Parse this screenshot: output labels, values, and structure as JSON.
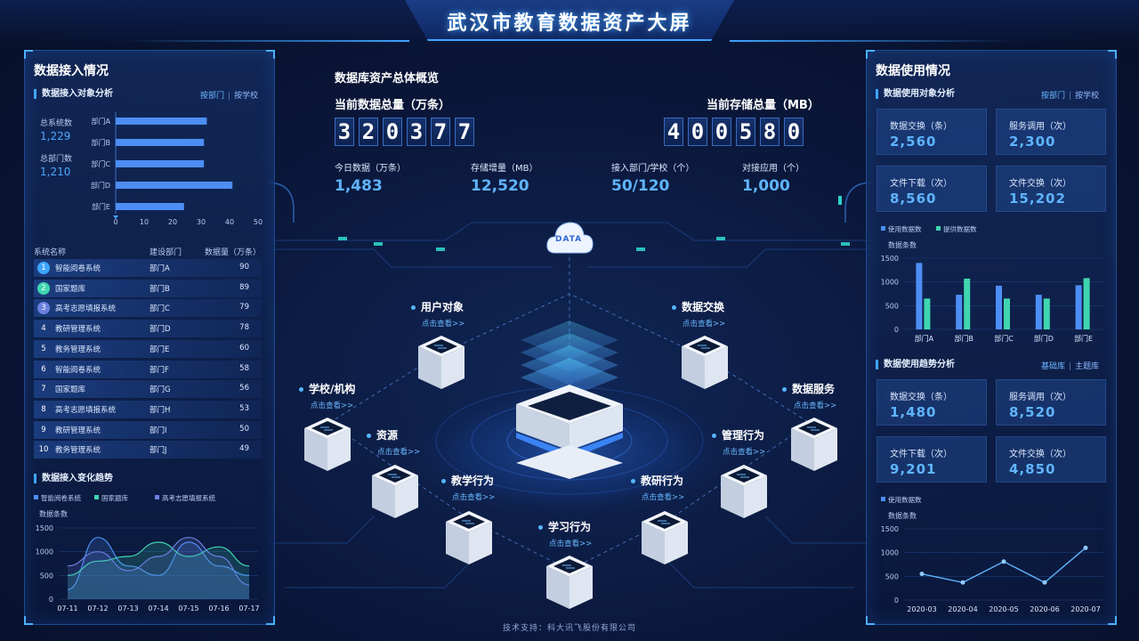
{
  "header": {
    "title": "武汉市教育数据资产大屏"
  },
  "left": {
    "title": "数据接入情况",
    "object_analysis": {
      "title": "数据接入对象分析",
      "tabs": [
        "按部门",
        "按学校"
      ],
      "total_systems_label": "总系统数",
      "total_systems": "1,229",
      "total_depts_label": "总部门数",
      "total_depts": "1,210"
    },
    "table": {
      "headers": [
        "系统名称",
        "建设部门",
        "数据量（万条）"
      ],
      "rows": [
        {
          "idx": "1",
          "name": "智能阅卷系统",
          "dept": "部门A",
          "value": "90"
        },
        {
          "idx": "2",
          "name": "国家题库",
          "dept": "部门B",
          "value": "89"
        },
        {
          "idx": "3",
          "name": "高考志愿填报系统",
          "dept": "部门C",
          "value": "79"
        },
        {
          "idx": "4",
          "name": "教研管理系统",
          "dept": "部门D",
          "value": "78"
        },
        {
          "idx": "5",
          "name": "教务管理系统",
          "dept": "部门E",
          "value": "60"
        },
        {
          "idx": "6",
          "name": "智能阅卷系统",
          "dept": "部门F",
          "value": "58"
        },
        {
          "idx": "7",
          "name": "国家题库",
          "dept": "部门G",
          "value": "56"
        },
        {
          "idx": "8",
          "name": "高考志愿填报系统",
          "dept": "部门H",
          "value": "53"
        },
        {
          "idx": "9",
          "name": "教研管理系统",
          "dept": "部门I",
          "value": "50"
        },
        {
          "idx": "10",
          "name": "教务管理系统",
          "dept": "部门J",
          "value": "49"
        }
      ]
    },
    "trend": {
      "title": "数据接入变化趋势",
      "ylabel": "数据条数"
    }
  },
  "center": {
    "overview_title": "数据库资产总体概览",
    "total_data_label": "当前数据总量（万条）",
    "total_data_digits": [
      "3",
      "2",
      "0",
      "3",
      "7",
      "7"
    ],
    "total_storage_label": "当前存储总量（MB）",
    "total_storage_digits": [
      "4",
      "0",
      "0",
      "5",
      "8",
      "0"
    ],
    "stats": [
      {
        "label": "今日数据（万条）",
        "value": "1,483"
      },
      {
        "label": "存储增量（MB）",
        "value": "12,520"
      },
      {
        "label": "接入部门/学校（个）",
        "value": "50/120"
      },
      {
        "label": "对接应用（个）",
        "value": "1,000"
      }
    ],
    "cloud_label": "DATA",
    "nodes": [
      {
        "label": "用户对象",
        "link": "点击查看>>"
      },
      {
        "label": "数据交换",
        "link": "点击查看>>"
      },
      {
        "label": "学校/机构",
        "link": "点击查看>>"
      },
      {
        "label": "数据服务",
        "link": "点击查看>>"
      },
      {
        "label": "资源",
        "link": "点击查看>>"
      },
      {
        "label": "管理行为",
        "link": "点击查看>>"
      },
      {
        "label": "教学行为",
        "link": "点击查看>>"
      },
      {
        "label": "教研行为",
        "link": "点击查看>>"
      },
      {
        "label": "学习行为",
        "link": "点击查看>>"
      }
    ]
  },
  "right": {
    "title": "数据使用情况",
    "object_analysis": {
      "title": "数据使用对象分析",
      "tabs": [
        "按部门",
        "按学校"
      ],
      "boxes": [
        {
          "label": "数据交换（条）",
          "value": "2,560"
        },
        {
          "label": "服务调用（次）",
          "value": "2,300"
        },
        {
          "label": "文件下载（次）",
          "value": "8,560"
        },
        {
          "label": "文件交换（次）",
          "value": "15,202"
        }
      ],
      "ylabel": "数据条数"
    },
    "trend": {
      "title": "数据使用趋势分析",
      "tabs": [
        "基础库",
        "主题库"
      ],
      "boxes": [
        {
          "label": "数据交换（条）",
          "value": "1,480"
        },
        {
          "label": "服务调用（次）",
          "value": "8,520"
        },
        {
          "label": "文件下载（次）",
          "value": "9,201"
        },
        {
          "label": "文件交换（次）",
          "value": "4,850"
        }
      ],
      "ylabel": "数据条数"
    }
  },
  "footer": "技术支持：科大讯飞股份有限公司",
  "colors": {
    "accent": "#3ea5ff",
    "bar_blue": "#4d8ef5",
    "bar_green": "#3fd6b0",
    "bg": "#0a1638"
  },
  "chart_data": [
    {
      "type": "bar",
      "orientation": "horizontal",
      "categories": [
        "部门A",
        "部门B",
        "部门C",
        "部门D",
        "部门E"
      ],
      "values": [
        32,
        31,
        31,
        41,
        24
      ],
      "xlim": [
        0,
        50
      ],
      "xticks": [
        "0",
        "10",
        "20",
        "30",
        "40",
        "50"
      ]
    },
    {
      "type": "area",
      "categories": [
        "07-11",
        "07-12",
        "07-13",
        "07-14",
        "07-15",
        "07-16",
        "07-17"
      ],
      "series": [
        {
          "name": "智能阅卷系统",
          "values": [
            200,
            1300,
            700,
            500,
            1200,
            700,
            500
          ]
        },
        {
          "name": "国家题库",
          "values": [
            500,
            800,
            900,
            1200,
            900,
            1100,
            700
          ]
        },
        {
          "name": "高考志愿填报系统",
          "values": [
            700,
            1000,
            600,
            900,
            1300,
            900,
            300
          ]
        }
      ],
      "ylim": [
        0,
        1500
      ],
      "yticks": [
        "0",
        "500",
        "1000",
        "1500"
      ],
      "ylabel": "数据条数"
    },
    {
      "type": "bar",
      "categories": [
        "部门A",
        "部门B",
        "部门C",
        "部门D",
        "部门E"
      ],
      "series": [
        {
          "name": "使用数据数",
          "values": [
            1400,
            730,
            920,
            730,
            930
          ]
        },
        {
          "name": "提供数据数",
          "values": [
            650,
            1070,
            650,
            650,
            1080
          ]
        }
      ],
      "ylim": [
        0,
        1500
      ],
      "yticks": [
        "0",
        "500",
        "1000",
        "1500"
      ],
      "ylabel": "数据条数"
    },
    {
      "type": "line",
      "categories": [
        "2020-03",
        "2020-04",
        "2020-05",
        "2020-06",
        "2020-07"
      ],
      "series": [
        {
          "name": "使用数据数",
          "values": [
            550,
            370,
            810,
            370,
            1100
          ]
        }
      ],
      "ylim": [
        0,
        1500
      ],
      "yticks": [
        "0",
        "500",
        "1000",
        "1500"
      ],
      "ylabel": "数据条数"
    }
  ]
}
